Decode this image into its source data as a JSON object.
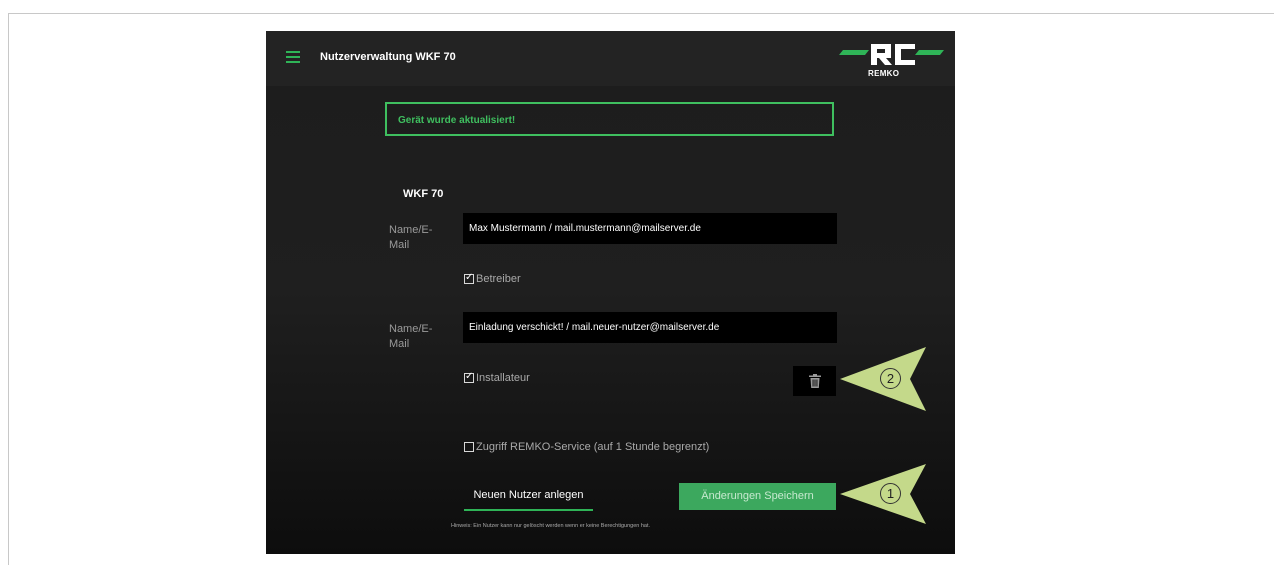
{
  "header": {
    "title": "Nutzerverwaltung WKF 70",
    "logo_text": "REMKO",
    "menu_icon": "hamburger-menu-icon",
    "brand_color": "#2fb457"
  },
  "notice": {
    "text": "Gerät wurde aktualisiert!",
    "color": "#3fbf5f"
  },
  "device": {
    "title": "WKF 70"
  },
  "users": [
    {
      "label": "Name/E-Mail",
      "value": "Max Mustermann / mail.mustermann@mailserver.de",
      "role_label": "Betreiber",
      "role_checked": true
    },
    {
      "label": "Name/E-Mail",
      "value": "Einladung verschickt! / mail.neuer-nutzer@mailserver.de",
      "role_label": "Installateur",
      "role_checked": true,
      "delete_icon": "trash-icon"
    }
  ],
  "service_access": {
    "label": "Zugriff REMKO-Service (auf 1 Stunde begrenzt)",
    "checked": false
  },
  "actions": {
    "new_user_label": "Neuen Nutzer anlegen",
    "save_label": "Änderungen Speichern",
    "save_color": "#3ca85e"
  },
  "hint": "Hinweis: Ein Nutzer kann nur gelöscht werden wenn er keine Berechtigungen hat.",
  "callouts": [
    {
      "number": "2",
      "target": "delete-button",
      "color": "#c4d98a"
    },
    {
      "number": "1",
      "target": "save-button",
      "color": "#c4d98a"
    }
  ]
}
